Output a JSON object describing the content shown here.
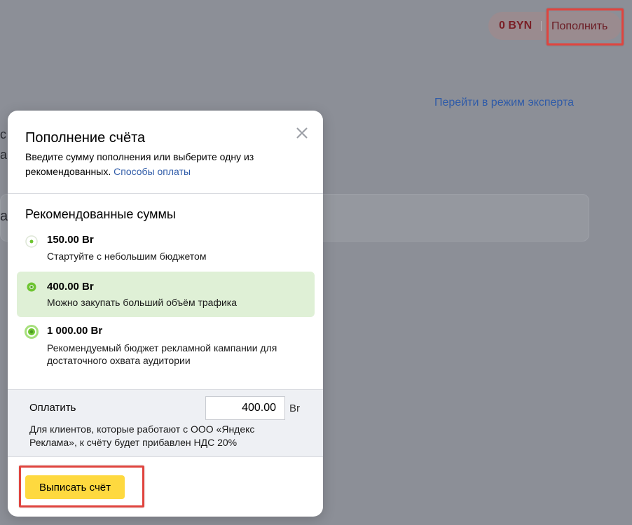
{
  "header": {
    "balance": "0 BYN",
    "topup_label": "Пополнить",
    "expert_mode_link": "Перейти в режим эксперта"
  },
  "background": {
    "edge_chars": [
      "с",
      "а",
      "а"
    ]
  },
  "modal": {
    "title": "Пополнение счёта",
    "description": "Введите сумму пополнения или выберите одну из рекомендованных.",
    "payment_methods_link": "Способы оплаты",
    "section_title": "Рекомендованные суммы",
    "options": [
      {
        "amount": "150.00 Br",
        "description": "Стартуйте с небольшим бюджетом",
        "selected": false
      },
      {
        "amount": "400.00 Br",
        "description": "Можно закупать больший объём трафика",
        "selected": true
      },
      {
        "amount": "1 000.00 Br",
        "description": "Рекомендуемый бюджет рекламной кампании для достаточного охвата аудитории",
        "selected": false
      }
    ],
    "pay_label": "Оплатить",
    "pay_value": "400.00",
    "currency": "Br",
    "vat_note": "Для клиентов, которые работают с ООО «Яндекс Реклама», к счёту будет прибавлен НДС 20%",
    "invoice_button": "Выписать счёт"
  },
  "colors": {
    "accent_yellow": "#fed93f",
    "selected_option_bg": "#dff0d6",
    "radio_green": "#6ec531",
    "link_blue": "#2f5ba8",
    "highlight_red": "#e0443e"
  },
  "icons": {
    "close": "close-icon",
    "radio_small": "radio-level-1-icon",
    "radio_medium": "radio-level-2-icon",
    "radio_large": "radio-level-3-icon"
  }
}
